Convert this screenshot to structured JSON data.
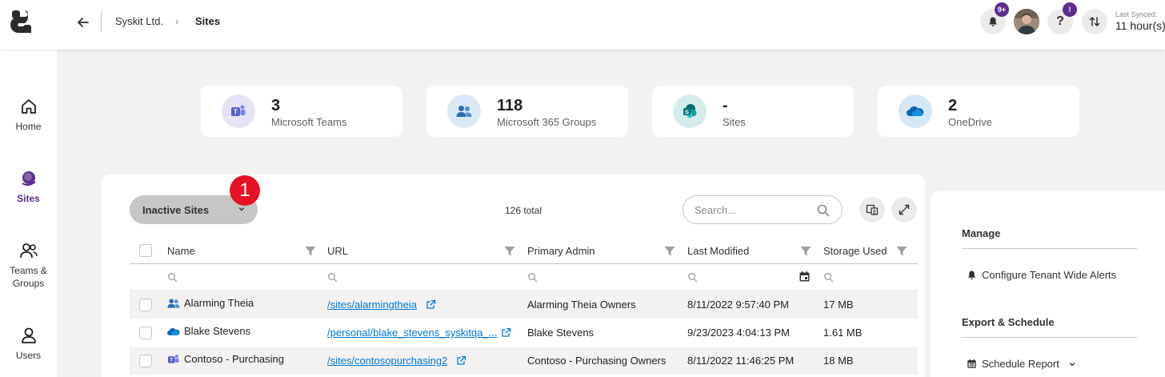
{
  "header": {
    "org": "Syskit Ltd.",
    "separator": "›",
    "current_page": "Sites",
    "notifications_badge": "9+",
    "help_badge": "!",
    "help_label": "?",
    "sync_label": "Last Synced:",
    "sync_value": "11 hour(s)"
  },
  "nav": {
    "items": [
      {
        "label": "Home",
        "icon": "home-icon"
      },
      {
        "label": "Sites",
        "icon": "sites-icon"
      },
      {
        "label": "Teams & Groups",
        "icon": "teams-groups-icon"
      },
      {
        "label": "Users",
        "icon": "user-icon"
      }
    ]
  },
  "summary": [
    {
      "value": "3",
      "label": "Microsoft Teams",
      "icon": "teams-icon",
      "color": "#e5e3f5"
    },
    {
      "value": "118",
      "label": "Microsoft 365 Groups",
      "icon": "groups-icon",
      "color": "#dbe9f6"
    },
    {
      "value": "-",
      "label": "Sites",
      "icon": "sharepoint-icon",
      "color": "#d5ecec"
    },
    {
      "value": "2",
      "label": "OneDrive",
      "icon": "onedrive-icon",
      "color": "#d3e7f7"
    }
  ],
  "toolbar": {
    "view_label": "Inactive Sites",
    "marker": "1",
    "total": "126 total",
    "search_placeholder": "Search..."
  },
  "table": {
    "columns": [
      "Name",
      "URL",
      "Primary Admin",
      "Last Modified",
      "Storage Used"
    ],
    "rows": [
      {
        "name": "Alarming Theia",
        "type": "group",
        "url": "/sites/alarmingtheia",
        "admin": "Alarming Theia Owners",
        "modified": "8/11/2022 9:57:40 PM",
        "storage": "17 MB"
      },
      {
        "name": "Blake Stevens",
        "type": "onedrive",
        "url": "/personal/blake_stevens_syskitqa_...",
        "admin": "Blake Stevens",
        "modified": "9/23/2023 4:04:13 PM",
        "storage": "1.61 MB"
      },
      {
        "name": "Contoso - Purchasing",
        "type": "teams",
        "url": "/sites/contosopurchasing2",
        "admin": "Contoso - Purchasing Owners",
        "modified": "8/11/2022 11:46:25 PM",
        "storage": "18 MB"
      }
    ]
  },
  "side_panel": {
    "manage_title": "Manage",
    "configure_alerts": "Configure Tenant Wide Alerts",
    "export_title": "Export & Schedule",
    "schedule_report": "Schedule Report"
  },
  "colors": {
    "accent": "#5c2d91",
    "link": "#0078d4",
    "marker": "#e81123"
  }
}
